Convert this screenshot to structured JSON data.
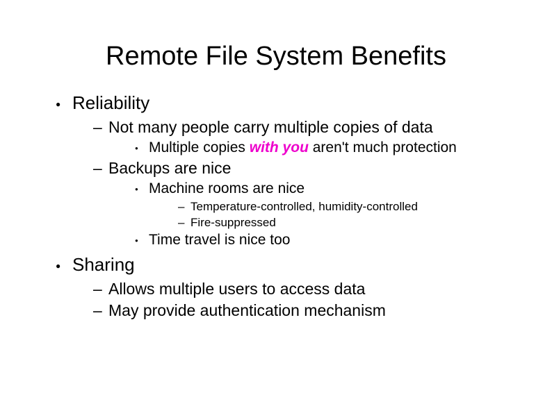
{
  "title": "Remote File System Benefits",
  "b1": {
    "reliability": "Reliability",
    "sharing": "Sharing"
  },
  "b2": {
    "not_many": "Not many people carry multiple copies of data",
    "backups": "Backups are nice",
    "allows": "Allows multiple users to access data",
    "auth": "May provide authentication mechanism"
  },
  "b3": {
    "mult_pre": "Multiple copies ",
    "mult_emph": "with you",
    "mult_post": " aren't much protection",
    "machine_rooms": "Machine rooms are nice",
    "time_travel": "Time travel is nice too"
  },
  "b4": {
    "temp": "Temperature-controlled, humidity-controlled",
    "fire": "Fire-suppressed"
  }
}
